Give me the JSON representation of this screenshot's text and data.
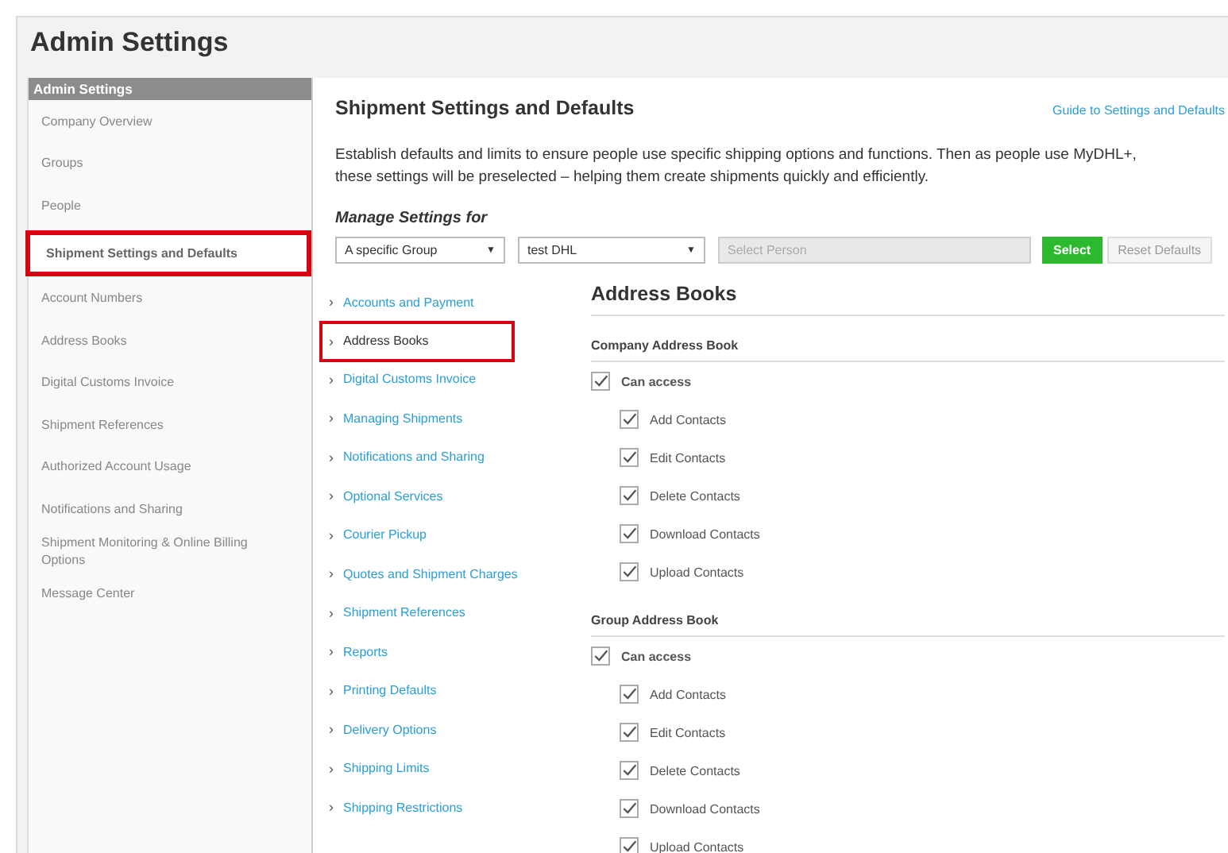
{
  "page_title": "Admin Settings",
  "sidebar": {
    "header": "Admin Settings",
    "items": [
      {
        "label": "Company Overview",
        "selected": false
      },
      {
        "label": "Groups",
        "selected": false
      },
      {
        "label": "People",
        "selected": false
      },
      {
        "label": "Shipment Settings and Defaults",
        "selected": true
      },
      {
        "label": "Account Numbers",
        "selected": false
      },
      {
        "label": "Address Books",
        "selected": false
      },
      {
        "label": "Digital Customs Invoice",
        "selected": false
      },
      {
        "label": "Shipment References",
        "selected": false
      },
      {
        "label": "Authorized Account Usage",
        "selected": false
      },
      {
        "label": "Notifications and Sharing",
        "selected": false
      },
      {
        "label": "Shipment Monitoring & Online Billing Options",
        "selected": false
      },
      {
        "label": "Message Center",
        "selected": false
      }
    ]
  },
  "main": {
    "title": "Shipment Settings and Defaults",
    "guide_link": "Guide to Settings and Defaults",
    "description": "Establish defaults and limits to ensure people use specific shipping options and functions. Then as people use MyDHL+, these settings will be preselected – helping them create shipments quickly and efficiently.",
    "manage_label": "Manage Settings for",
    "scope_select": {
      "value": "A specific Group",
      "arrow": "▼"
    },
    "group_select": {
      "value": "test DHL",
      "arrow": "▼"
    },
    "person_field": {
      "placeholder": "Select Person",
      "disabled": true
    },
    "buttons": [
      {
        "label": "Select",
        "disabled": false
      },
      {
        "label": "Reset Defaults",
        "disabled": true
      }
    ]
  },
  "settings_nav": {
    "arrow": "›",
    "items": [
      {
        "label": "Accounts and Payment",
        "selected": false
      },
      {
        "label": "Address Books",
        "selected": true
      },
      {
        "label": "Digital Customs Invoice",
        "selected": false
      },
      {
        "label": "Managing Shipments",
        "selected": false
      },
      {
        "label": "Notifications and Sharing",
        "selected": false
      },
      {
        "label": "Optional Services",
        "selected": false
      },
      {
        "label": "Courier Pickup",
        "selected": false
      },
      {
        "label": "Quotes and Shipment Charges",
        "selected": false
      },
      {
        "label": "Shipment References",
        "selected": false
      },
      {
        "label": "Reports",
        "selected": false
      },
      {
        "label": "Printing Defaults",
        "selected": false
      },
      {
        "label": "Delivery Options",
        "selected": false
      },
      {
        "label": "Shipping Limits",
        "selected": false
      },
      {
        "label": "Shipping Restrictions",
        "selected": false
      }
    ]
  },
  "panel": {
    "title": "Address Books",
    "sections": [
      {
        "heading": "Company Address Book",
        "access": {
          "label": "Can access",
          "checked": true
        },
        "options": [
          {
            "label": "Add Contacts",
            "checked": true
          },
          {
            "label": "Edit Contacts",
            "checked": true
          },
          {
            "label": "Delete Contacts",
            "checked": true
          },
          {
            "label": "Download Contacts",
            "checked": true
          },
          {
            "label": "Upload Contacts",
            "checked": true
          }
        ]
      },
      {
        "heading": "Group Address Book",
        "access": {
          "label": "Can access",
          "checked": true
        },
        "options": [
          {
            "label": "Add Contacts",
            "checked": true
          },
          {
            "label": "Edit Contacts",
            "checked": true
          },
          {
            "label": "Delete Contacts",
            "checked": true
          },
          {
            "label": "Download Contacts",
            "checked": true
          },
          {
            "label": "Upload Contacts",
            "checked": true
          }
        ]
      }
    ]
  }
}
